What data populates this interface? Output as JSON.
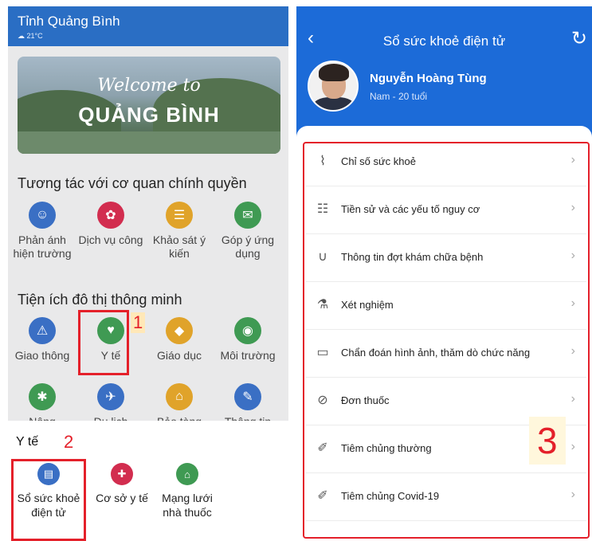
{
  "left": {
    "city": "Tỉnh Quảng Bình",
    "weather": "☁ 21°C",
    "banner": {
      "script": "Welcome to",
      "main": "QUẢNG BÌNH"
    },
    "section1": "Tương tác với cơ quan chính quyền",
    "section1_items": [
      {
        "label": "Phản ánh hiện trường",
        "color": "#3a6fc4",
        "icon": "megaphone-icon"
      },
      {
        "label": "Dịch vụ công",
        "color": "#d22d4f",
        "icon": "star-icon"
      },
      {
        "label": "Khảo sát ý kiến",
        "color": "#e0a32a",
        "icon": "survey-icon"
      },
      {
        "label": "Góp ý ứng dụng",
        "color": "#3f9a53",
        "icon": "feedback-icon"
      }
    ],
    "section2": "Tiện ích đô thị thông minh",
    "section2_items": [
      {
        "label": "Giao thông",
        "color": "#3a6fc4",
        "icon": "traffic-icon"
      },
      {
        "label": "Y tế",
        "color": "#3f9a53",
        "icon": "health-heart-icon"
      },
      {
        "label": "Giáo dục",
        "color": "#e0a32a",
        "icon": "graduation-icon"
      },
      {
        "label": "Môi trường",
        "color": "#3f9a53",
        "icon": "globe-icon"
      }
    ],
    "section2_row2": [
      {
        "label": "Nông",
        "color": "#3f9a53"
      },
      {
        "label": "Du lịch",
        "color": "#3a6fc4"
      },
      {
        "label": "Bảo tàng",
        "color": "#e0a32a"
      },
      {
        "label": "Thông tin",
        "color": "#3a6fc4"
      }
    ],
    "marker1": "1",
    "sheet": {
      "title": "Y tế",
      "marker": "2",
      "items": [
        {
          "label": "Sổ sức khoẻ điện tử",
          "color": "#3a6fc4"
        },
        {
          "label": "Cơ sở y tế",
          "color": "#d22d4f"
        },
        {
          "label": "Mạng lưới nhà thuốc",
          "color": "#3f9a53"
        }
      ]
    }
  },
  "right": {
    "title": "Sổ sức khoẻ điện tử",
    "user_name": "Nguyễn Hoàng Tùng",
    "user_info": "Nam - 20 tuổi",
    "items": [
      "Chỉ số sức khoẻ",
      "Tiền sử và các yếu tố nguy cơ",
      "Thông tin đợt khám chữa bệnh",
      "Xét nghiệm",
      "Chẩn đoán hình ảnh, thăm dò chức năng",
      "Đơn thuốc",
      "Tiêm chủng thường",
      "Tiêm chủng Covid-19"
    ],
    "marker3": "3"
  }
}
